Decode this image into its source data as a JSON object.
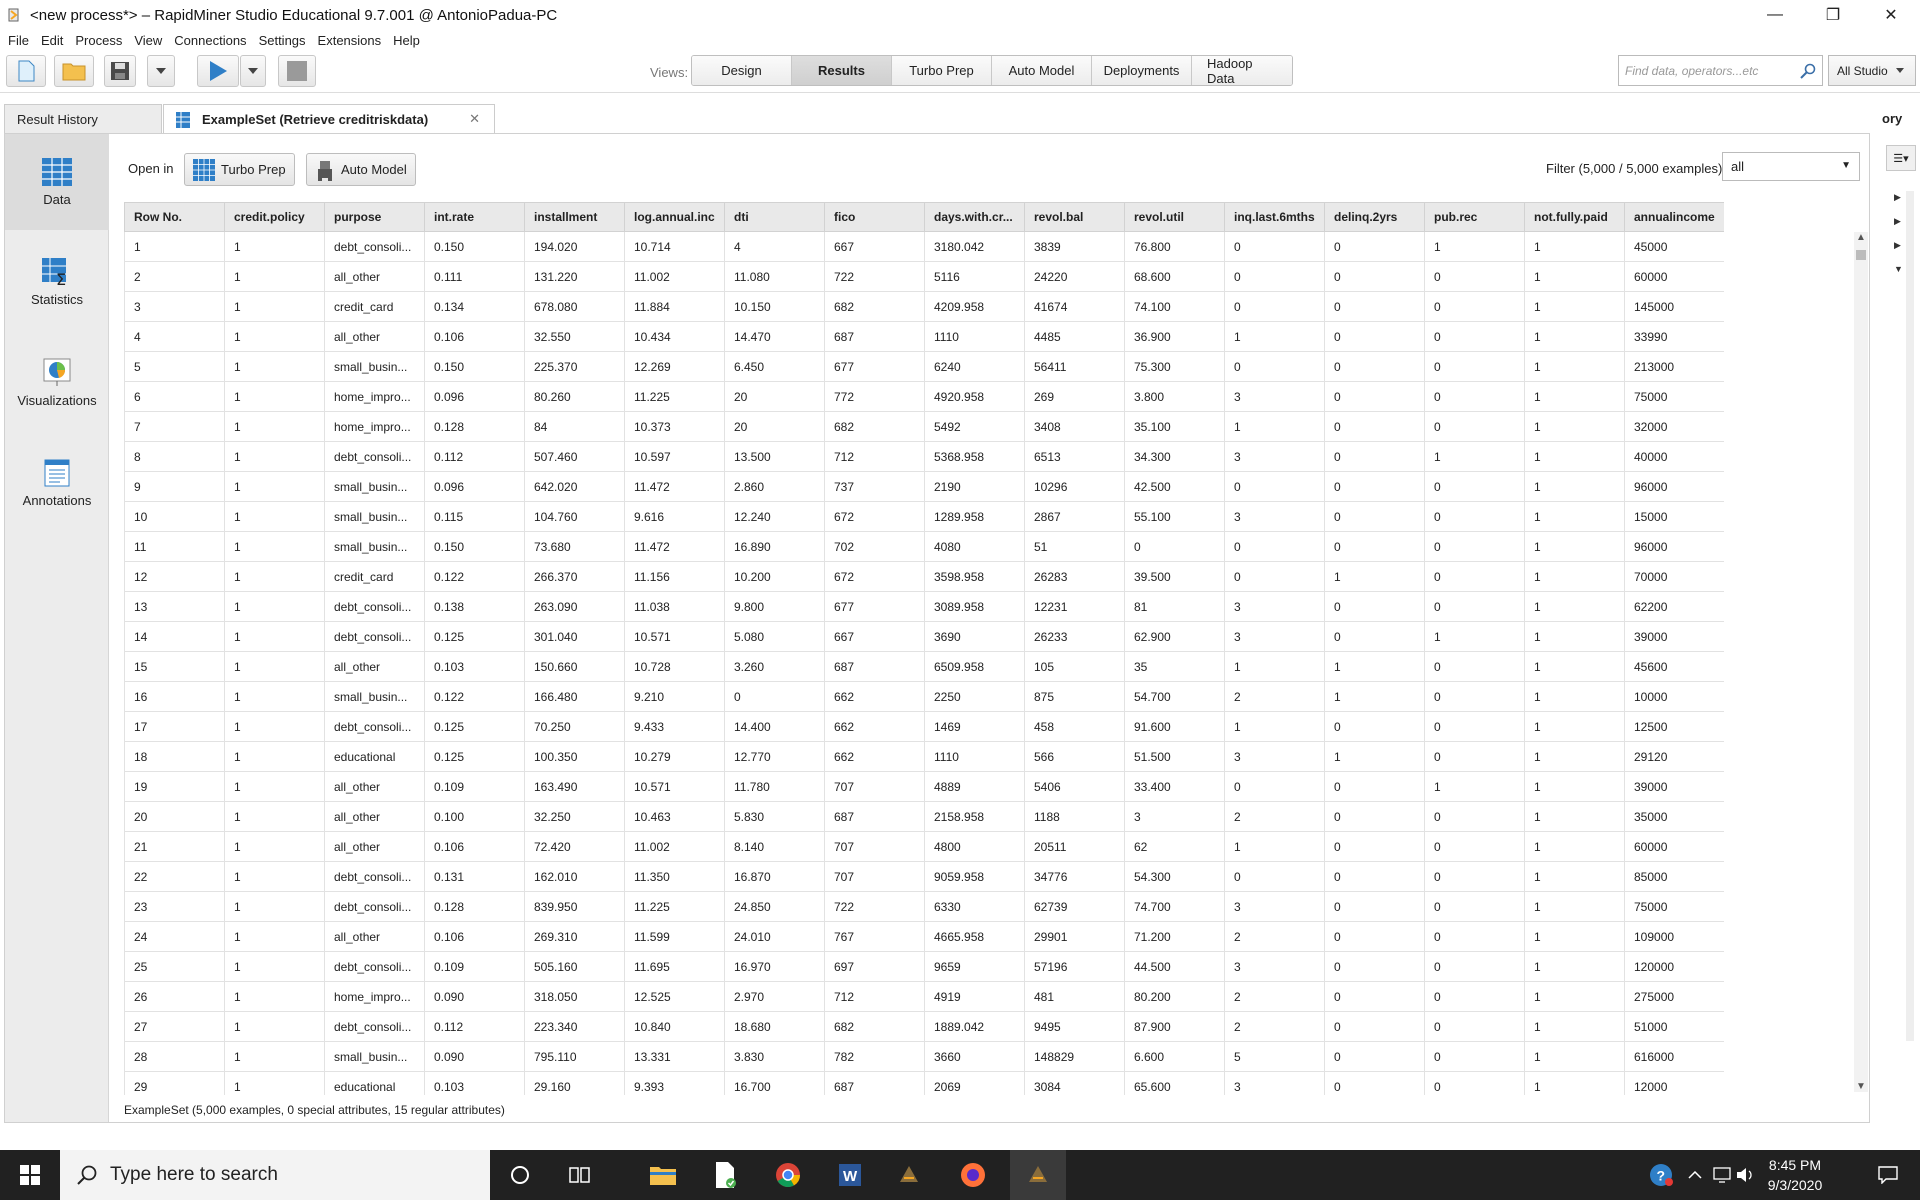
{
  "window": {
    "title": "<new process*> – RapidMiner Studio Educational 9.7.001 @ AntonioPadua-PC",
    "minimize_glyph": "—",
    "restore_glyph": "❐",
    "close_glyph": "✕"
  },
  "menu": [
    "File",
    "Edit",
    "Process",
    "View",
    "Connections",
    "Settings",
    "Extensions",
    "Help"
  ],
  "toolbar": {
    "views_label": "Views:",
    "views": [
      "Design",
      "Results",
      "Turbo Prep",
      "Auto Model",
      "Deployments",
      "Hadoop Data"
    ],
    "active_view": "Results",
    "search_placeholder": "Find data, operators...etc",
    "studio_dropdown": "All Studio"
  },
  "tabs": {
    "result_history": "Result History",
    "example_set": "ExampleSet (Retrieve creditriskdata)",
    "close_glyph": "✕",
    "right_fragment": "ory"
  },
  "sidebar": [
    {
      "label": "Data",
      "icon": "table-icon"
    },
    {
      "label": "Statistics",
      "icon": "statistics-icon"
    },
    {
      "label": "Visualizations",
      "icon": "chart-icon"
    },
    {
      "label": "Annotations",
      "icon": "notes-icon"
    }
  ],
  "open_in": {
    "label": "Open in",
    "turbo_prep": "Turbo Prep",
    "auto_model": "Auto Model"
  },
  "filter": {
    "label": "Filter (5,000 / 5,000 examples):",
    "value": "all"
  },
  "table": {
    "columns": [
      "Row No.",
      "credit.policy",
      "purpose",
      "int.rate",
      "installment",
      "log.annual.inc",
      "dti",
      "fico",
      "days.with.cr...",
      "revol.bal",
      "revol.util",
      "inq.last.6mths",
      "delinq.2yrs",
      "pub.rec",
      "not.fully.paid",
      "annualincome"
    ],
    "rows": [
      [
        "1",
        "1",
        "debt_consoli...",
        "0.150",
        "194.020",
        "10.714",
        "4",
        "667",
        "3180.042",
        "3839",
        "76.800",
        "0",
        "0",
        "1",
        "1",
        "45000"
      ],
      [
        "2",
        "1",
        "all_other",
        "0.111",
        "131.220",
        "11.002",
        "11.080",
        "722",
        "5116",
        "24220",
        "68.600",
        "0",
        "0",
        "0",
        "1",
        "60000"
      ],
      [
        "3",
        "1",
        "credit_card",
        "0.134",
        "678.080",
        "11.884",
        "10.150",
        "682",
        "4209.958",
        "41674",
        "74.100",
        "0",
        "0",
        "0",
        "1",
        "145000"
      ],
      [
        "4",
        "1",
        "all_other",
        "0.106",
        "32.550",
        "10.434",
        "14.470",
        "687",
        "1110",
        "4485",
        "36.900",
        "1",
        "0",
        "0",
        "1",
        "33990"
      ],
      [
        "5",
        "1",
        "small_busin...",
        "0.150",
        "225.370",
        "12.269",
        "6.450",
        "677",
        "6240",
        "56411",
        "75.300",
        "0",
        "0",
        "0",
        "1",
        "213000"
      ],
      [
        "6",
        "1",
        "home_impro...",
        "0.096",
        "80.260",
        "11.225",
        "20",
        "772",
        "4920.958",
        "269",
        "3.800",
        "3",
        "0",
        "0",
        "1",
        "75000"
      ],
      [
        "7",
        "1",
        "home_impro...",
        "0.128",
        "84",
        "10.373",
        "20",
        "682",
        "5492",
        "3408",
        "35.100",
        "1",
        "0",
        "0",
        "1",
        "32000"
      ],
      [
        "8",
        "1",
        "debt_consoli...",
        "0.112",
        "507.460",
        "10.597",
        "13.500",
        "712",
        "5368.958",
        "6513",
        "34.300",
        "3",
        "0",
        "1",
        "1",
        "40000"
      ],
      [
        "9",
        "1",
        "small_busin...",
        "0.096",
        "642.020",
        "11.472",
        "2.860",
        "737",
        "2190",
        "10296",
        "42.500",
        "0",
        "0",
        "0",
        "1",
        "96000"
      ],
      [
        "10",
        "1",
        "small_busin...",
        "0.115",
        "104.760",
        "9.616",
        "12.240",
        "672",
        "1289.958",
        "2867",
        "55.100",
        "3",
        "0",
        "0",
        "1",
        "15000"
      ],
      [
        "11",
        "1",
        "small_busin...",
        "0.150",
        "73.680",
        "11.472",
        "16.890",
        "702",
        "4080",
        "51",
        "0",
        "0",
        "0",
        "0",
        "1",
        "96000"
      ],
      [
        "12",
        "1",
        "credit_card",
        "0.122",
        "266.370",
        "11.156",
        "10.200",
        "672",
        "3598.958",
        "26283",
        "39.500",
        "0",
        "1",
        "0",
        "1",
        "70000"
      ],
      [
        "13",
        "1",
        "debt_consoli...",
        "0.138",
        "263.090",
        "11.038",
        "9.800",
        "677",
        "3089.958",
        "12231",
        "81",
        "3",
        "0",
        "0",
        "1",
        "62200"
      ],
      [
        "14",
        "1",
        "debt_consoli...",
        "0.125",
        "301.040",
        "10.571",
        "5.080",
        "667",
        "3690",
        "26233",
        "62.900",
        "3",
        "0",
        "1",
        "1",
        "39000"
      ],
      [
        "15",
        "1",
        "all_other",
        "0.103",
        "150.660",
        "10.728",
        "3.260",
        "687",
        "6509.958",
        "105",
        "35",
        "1",
        "1",
        "0",
        "1",
        "45600"
      ],
      [
        "16",
        "1",
        "small_busin...",
        "0.122",
        "166.480",
        "9.210",
        "0",
        "662",
        "2250",
        "875",
        "54.700",
        "2",
        "1",
        "0",
        "1",
        "10000"
      ],
      [
        "17",
        "1",
        "debt_consoli...",
        "0.125",
        "70.250",
        "9.433",
        "14.400",
        "662",
        "1469",
        "458",
        "91.600",
        "1",
        "0",
        "0",
        "1",
        "12500"
      ],
      [
        "18",
        "1",
        "educational",
        "0.125",
        "100.350",
        "10.279",
        "12.770",
        "662",
        "1110",
        "566",
        "51.500",
        "3",
        "1",
        "0",
        "1",
        "29120"
      ],
      [
        "19",
        "1",
        "all_other",
        "0.109",
        "163.490",
        "10.571",
        "11.780",
        "707",
        "4889",
        "5406",
        "33.400",
        "0",
        "0",
        "1",
        "1",
        "39000"
      ],
      [
        "20",
        "1",
        "all_other",
        "0.100",
        "32.250",
        "10.463",
        "5.830",
        "687",
        "2158.958",
        "1188",
        "3",
        "2",
        "0",
        "0",
        "1",
        "35000"
      ],
      [
        "21",
        "1",
        "all_other",
        "0.106",
        "72.420",
        "11.002",
        "8.140",
        "707",
        "4800",
        "20511",
        "62",
        "1",
        "0",
        "0",
        "1",
        "60000"
      ],
      [
        "22",
        "1",
        "debt_consoli...",
        "0.131",
        "162.010",
        "11.350",
        "16.870",
        "707",
        "9059.958",
        "34776",
        "54.300",
        "0",
        "0",
        "0",
        "1",
        "85000"
      ],
      [
        "23",
        "1",
        "debt_consoli...",
        "0.128",
        "839.950",
        "11.225",
        "24.850",
        "722",
        "6330",
        "62739",
        "74.700",
        "3",
        "0",
        "0",
        "1",
        "75000"
      ],
      [
        "24",
        "1",
        "all_other",
        "0.106",
        "269.310",
        "11.599",
        "24.010",
        "767",
        "4665.958",
        "29901",
        "71.200",
        "2",
        "0",
        "0",
        "1",
        "109000"
      ],
      [
        "25",
        "1",
        "debt_consoli...",
        "0.109",
        "505.160",
        "11.695",
        "16.970",
        "697",
        "9659",
        "57196",
        "44.500",
        "3",
        "0",
        "0",
        "1",
        "120000"
      ],
      [
        "26",
        "1",
        "home_impro...",
        "0.090",
        "318.050",
        "12.525",
        "2.970",
        "712",
        "4919",
        "481",
        "80.200",
        "2",
        "0",
        "0",
        "1",
        "275000"
      ],
      [
        "27",
        "1",
        "debt_consoli...",
        "0.112",
        "223.340",
        "10.840",
        "18.680",
        "682",
        "1889.042",
        "9495",
        "87.900",
        "2",
        "0",
        "0",
        "1",
        "51000"
      ],
      [
        "28",
        "1",
        "small_busin...",
        "0.090",
        "795.110",
        "13.331",
        "3.830",
        "782",
        "3660",
        "148829",
        "6.600",
        "5",
        "0",
        "0",
        "1",
        "616000"
      ],
      [
        "29",
        "1",
        "educational",
        "0.103",
        "29.160",
        "9.393",
        "16.700",
        "687",
        "2069",
        "3084",
        "65.600",
        "3",
        "0",
        "0",
        "1",
        "12000"
      ]
    ]
  },
  "status": "ExampleSet (5,000 examples, 0 special attributes, 15 regular attributes)",
  "taskbar": {
    "search_placeholder": "Type here to search",
    "time": "8:45 PM",
    "date": "9/3/2020"
  }
}
